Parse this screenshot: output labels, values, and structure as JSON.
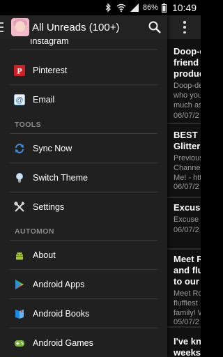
{
  "status_bar": {
    "battery": "86%",
    "time": "10:49"
  },
  "app_bar": {
    "title": "All Unreads (100+)"
  },
  "drawer": {
    "partial_top_item": "Instagram",
    "items_share": [
      {
        "label": "Pinterest",
        "icon": "pinterest-icon"
      },
      {
        "label": "Email",
        "icon": "email-icon"
      }
    ],
    "tools_header": "TOOLS",
    "items_tools": [
      {
        "label": "Sync Now",
        "icon": "sync-icon"
      },
      {
        "label": "Switch Theme",
        "icon": "lightbulb-icon"
      },
      {
        "label": "Settings",
        "icon": "tools-icon"
      }
    ],
    "automon_header": "AUTOMON",
    "items_automon": [
      {
        "label": "About",
        "icon": "android-icon"
      },
      {
        "label": "Android Apps",
        "icon": "play-store-icon"
      },
      {
        "label": "Android Books",
        "icon": "books-icon"
      },
      {
        "label": "Android Games",
        "icon": "gamepad-icon"
      }
    ]
  },
  "feed": {
    "items": [
      {
        "title_lines": [
          "Doop-d",
          "friend w",
          "produc"
        ],
        "snippet_lines": [
          "Doop-de",
          "who you",
          "much as"
        ],
        "date": "06/07/2"
      },
      {
        "title_lines": [
          "BEST E",
          "Glitter"
        ],
        "snippet_lines": [
          "Previous",
          "Channe",
          "Me! - htt"
        ],
        "date": "06/07/2"
      },
      {
        "title_lines": [
          "Excuse"
        ],
        "snippet_lines": [
          "Excuse"
        ],
        "date": "06/07/2"
      },
      {
        "title_lines": [
          "Meet R",
          "and flu",
          "to our f"
        ],
        "snippet_lines": [
          "Meet Ro",
          "fluffiest",
          "family! W"
        ],
        "date": "05/07/2"
      },
      {
        "title_lines": [
          "I've kno",
          "weeks"
        ],
        "snippet_lines": [],
        "date": ""
      }
    ]
  },
  "colors": {
    "drawer_bg": "#202020",
    "app_bar_bg": "#222222",
    "pinterest_red": "#cc2127",
    "sync_blue": "#3d8fe0",
    "android_green": "#a4c639"
  }
}
